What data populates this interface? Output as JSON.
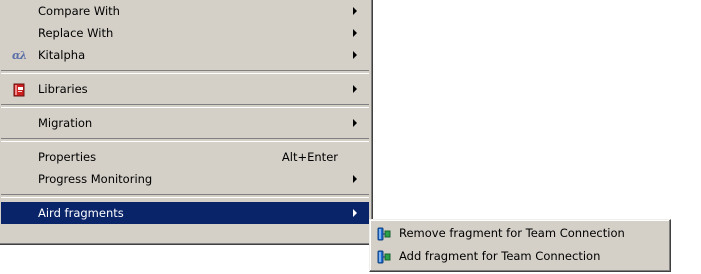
{
  "context_menu": {
    "items": [
      {
        "label": "Compare With",
        "has_submenu": true
      },
      {
        "label": "Replace With",
        "has_submenu": true
      },
      {
        "label": "Kitalpha",
        "has_submenu": true,
        "icon": "kitalpha-icon",
        "icon_glyph": "αλ"
      },
      {
        "label": "Libraries",
        "has_submenu": true,
        "icon": "libraries-book-icon"
      },
      {
        "label": "Migration",
        "has_submenu": true
      },
      {
        "label": "Properties",
        "shortcut": "Alt+Enter"
      },
      {
        "label": "Progress Monitoring",
        "has_submenu": true
      },
      {
        "label": "Aird fragments",
        "has_submenu": true,
        "highlighted": true
      }
    ]
  },
  "submenu": {
    "items": [
      {
        "label": "Remove fragment for Team Connection",
        "icon": "fragment-icon"
      },
      {
        "label": "Add fragment for Team Connection",
        "icon": "fragment-icon"
      }
    ]
  },
  "colors": {
    "menu_background": "#d4d0c8",
    "highlight": "#0a246a",
    "highlight_text": "#ffffff",
    "libraries_icon": "#cc1f1f",
    "fragment_icon": "#1f6fd1"
  }
}
